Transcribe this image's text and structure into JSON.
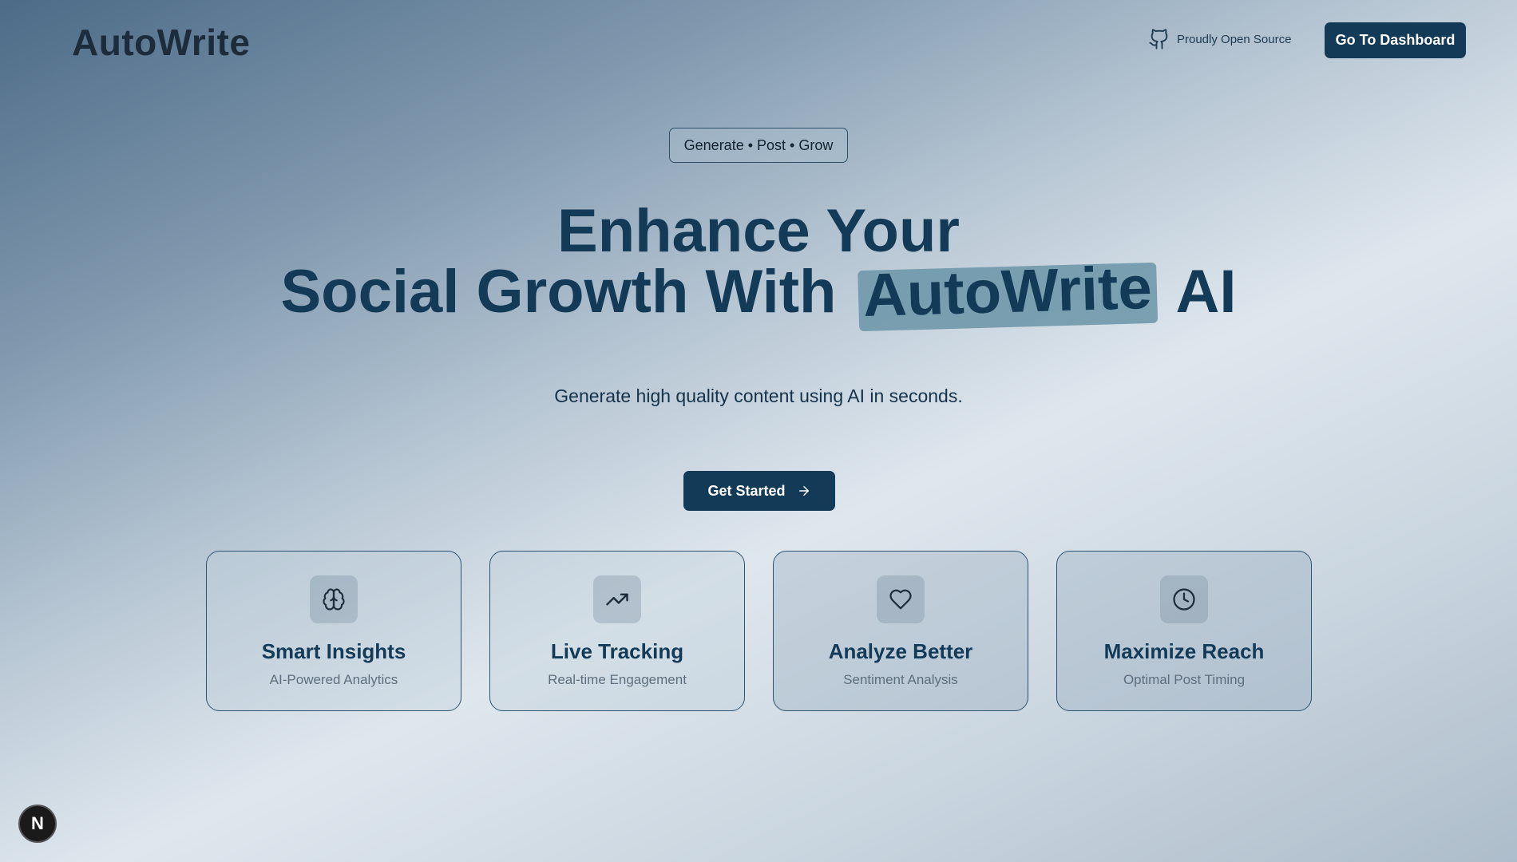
{
  "header": {
    "logo": "AutoWrite",
    "open_source_label": "Proudly Open Source",
    "dashboard_button": "Go To Dashboard"
  },
  "hero": {
    "tagline": "Generate • Post • Grow",
    "line1": "Enhance Your",
    "line2_prefix": "Social Growth With",
    "line2_highlight": "AutoWrite",
    "line2_suffix": "AI",
    "subtitle": "Generate high quality content using AI in seconds.",
    "cta_label": "Get Started"
  },
  "features": [
    {
      "title": "Smart Insights",
      "subtitle": "AI-Powered Analytics",
      "icon": "brain-icon"
    },
    {
      "title": "Live Tracking",
      "subtitle": "Real-time Engagement",
      "icon": "trending-up-icon"
    },
    {
      "title": "Analyze Better",
      "subtitle": "Sentiment Analysis",
      "icon": "heart-icon"
    },
    {
      "title": "Maximize Reach",
      "subtitle": "Optimal Post Timing",
      "icon": "clock-icon"
    }
  ],
  "badge": {
    "letter": "N"
  },
  "colors": {
    "primary": "#133a57",
    "highlight": "#6f98ab"
  }
}
